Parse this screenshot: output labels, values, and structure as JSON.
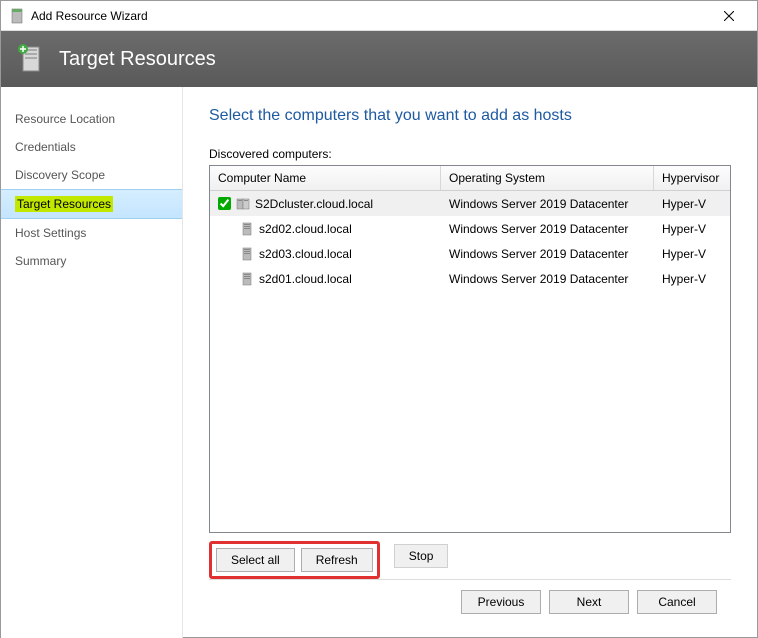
{
  "window": {
    "title": "Add Resource Wizard",
    "header": "Target Resources"
  },
  "sidebar": {
    "steps": [
      {
        "label": "Resource Location"
      },
      {
        "label": "Credentials"
      },
      {
        "label": "Discovery Scope"
      },
      {
        "label": "Target Resources",
        "active": true
      },
      {
        "label": "Host Settings"
      },
      {
        "label": "Summary"
      }
    ]
  },
  "main": {
    "heading": "Select the computers that you want to add as hosts",
    "list_label": "Discovered computers:",
    "columns": {
      "name": "Computer Name",
      "os": "Operating System",
      "hv": "Hypervisor"
    },
    "rows": [
      {
        "checked": true,
        "name": "S2Dcluster.cloud.local",
        "os": "Windows Server 2019 Datacenter",
        "hv": "Hyper-V",
        "cluster": true,
        "selected": true
      },
      {
        "checked": false,
        "name": "s2d02.cloud.local",
        "os": "Windows Server 2019 Datacenter",
        "hv": "Hyper-V"
      },
      {
        "checked": false,
        "name": "s2d03.cloud.local",
        "os": "Windows Server 2019 Datacenter",
        "hv": "Hyper-V"
      },
      {
        "checked": false,
        "name": "s2d01.cloud.local",
        "os": "Windows Server 2019 Datacenter",
        "hv": "Hyper-V"
      }
    ],
    "buttons": {
      "select_all": "Select all",
      "refresh": "Refresh",
      "stop": "Stop"
    }
  },
  "footer": {
    "previous": "Previous",
    "next": "Next",
    "cancel": "Cancel"
  }
}
